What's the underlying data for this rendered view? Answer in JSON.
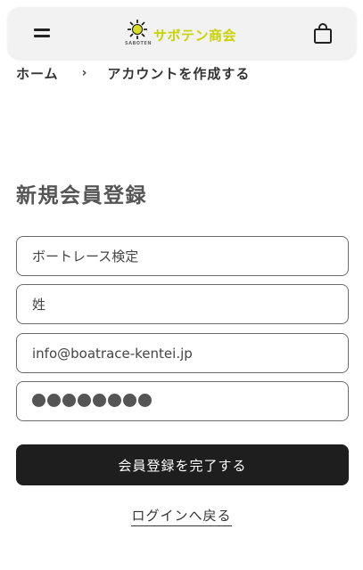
{
  "header": {
    "logo_text": "サボテン商会",
    "logo_sub": "SABOTEN",
    "logo_color": "#c9d400"
  },
  "icons": {
    "menu": "hamburger-icon",
    "cart": "shopping-bag-icon"
  },
  "breadcrumb": {
    "home": "ホーム",
    "separator": "›",
    "current": "アカウントを作成する"
  },
  "page": {
    "title": "新規会員登録"
  },
  "form": {
    "field1_value": "ボートレース検定",
    "field2_value": "姓",
    "email_value": "info@boatrace-kentei.jp",
    "password_length": 8,
    "submit_label": "会員登録を完了する",
    "login_link": "ログインへ戻る"
  }
}
